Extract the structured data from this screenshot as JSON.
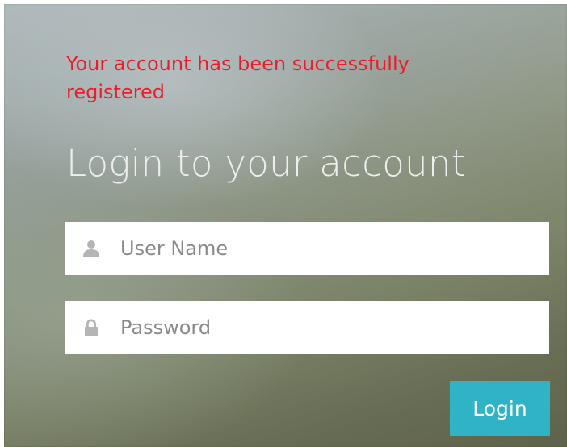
{
  "messages": {
    "success": "Your account has been successfully registered"
  },
  "login": {
    "title": "Login to your account",
    "username": {
      "value": "",
      "placeholder": "User Name",
      "icon": "user-icon"
    },
    "password": {
      "value": "",
      "placeholder": "Password",
      "icon": "lock-icon"
    },
    "button_label": "Login"
  },
  "colors": {
    "success_text": "#ee1c2b",
    "button_bg": "#2fb4c6",
    "title_text": "#ecefee",
    "icon_gray": "#b5b5b5"
  }
}
